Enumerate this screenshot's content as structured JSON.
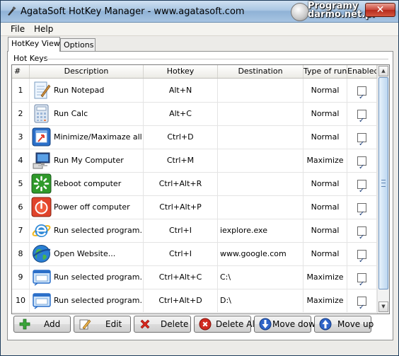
{
  "window": {
    "title": "AgataSoft HotKey Manager  -  www.agatasoft.com",
    "close_label": "✕"
  },
  "watermark": {
    "line1": "Programy",
    "line2": "darmo.net.pl"
  },
  "menu": {
    "items": [
      "File",
      "Help"
    ]
  },
  "tabs": [
    {
      "label": "HotKey View",
      "active": true
    },
    {
      "label": "Options",
      "active": false
    }
  ],
  "group": {
    "label": "Hot Keys"
  },
  "table": {
    "columns": [
      "#",
      "Description",
      "Hotkey",
      "Destination",
      "Type of run",
      "Enabled"
    ],
    "rows": [
      {
        "num": "1",
        "icon": "notepad-icon",
        "description": "Run Notepad",
        "hotkey": "Alt+N",
        "destination": "",
        "type": "Normal",
        "enabled": true
      },
      {
        "num": "2",
        "icon": "calculator-icon",
        "description": "Run Calc",
        "hotkey": "Alt+C",
        "destination": "",
        "type": "Normal",
        "enabled": true
      },
      {
        "num": "3",
        "icon": "minimize-maximize-icon",
        "description": "Minimize/Maximaze all ...",
        "hotkey": "Ctrl+D",
        "destination": "",
        "type": "Normal",
        "enabled": true
      },
      {
        "num": "4",
        "icon": "my-computer-icon",
        "description": "Run My Computer",
        "hotkey": "Ctrl+M",
        "destination": "",
        "type": "Maximize",
        "enabled": true
      },
      {
        "num": "5",
        "icon": "reboot-icon",
        "description": "Reboot computer",
        "hotkey": "Ctrl+Alt+R",
        "destination": "",
        "type": "Normal",
        "enabled": true
      },
      {
        "num": "6",
        "icon": "power-off-icon",
        "description": "Power off computer",
        "hotkey": "Ctrl+Alt+P",
        "destination": "",
        "type": "Normal",
        "enabled": true
      },
      {
        "num": "7",
        "icon": "internet-explorer-icon",
        "description": "Run selected program...",
        "hotkey": "Ctrl+I",
        "destination": "iexplore.exe",
        "type": "Normal",
        "enabled": true
      },
      {
        "num": "8",
        "icon": "globe-icon",
        "description": "Open Website...",
        "hotkey": "Ctrl+I",
        "destination": "www.google.com",
        "type": "Normal",
        "enabled": true
      },
      {
        "num": "9",
        "icon": "program-window-icon",
        "description": "Run selected program...",
        "hotkey": "Ctrl+Alt+C",
        "destination": "C:\\",
        "type": "Maximize",
        "enabled": true
      },
      {
        "num": "10",
        "icon": "program-window-icon",
        "description": "Run selected program...",
        "hotkey": "Ctrl+Alt+D",
        "destination": "D:\\",
        "type": "Maximize",
        "enabled": true
      }
    ]
  },
  "buttons": {
    "add": "Add",
    "edit": "Edit",
    "delete": "Delete",
    "delete_all": "Delete All",
    "move_down": "Move down",
    "move_up": "Move up"
  }
}
